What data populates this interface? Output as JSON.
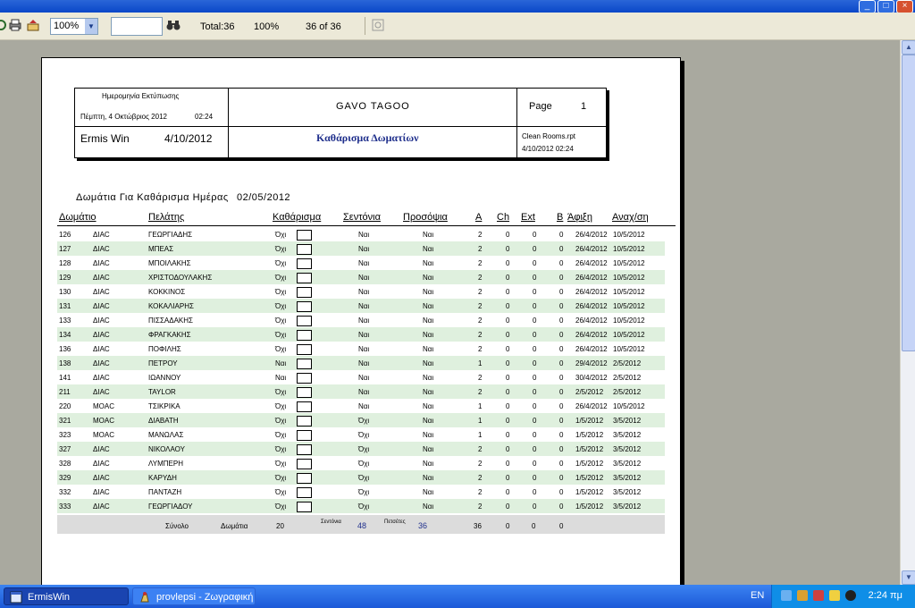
{
  "toolbar": {
    "zoom": "100%",
    "search_value": "",
    "total": "Total:36",
    "percent": "100%",
    "page_of": "36 of 36"
  },
  "report": {
    "print_date_label": "Ημερομηνία Εκτύπωσης",
    "print_date_value": "Πέμπτη, 4 Οκτώβριος 2012",
    "print_time": "02:24",
    "company": "GAVO TAGOO",
    "page_label": "Page",
    "page_number": "1",
    "app_name": "Ermis Win",
    "app_date": "4/10/2012",
    "report_title": "Καθάρισμα Δωματίων",
    "report_file": "Clean Rooms.rpt",
    "report_file_datetime": "4/10/2012  02:24",
    "section_title": "Δωμάτια Για Καθάρισμα Ημέρας",
    "section_date": "02/05/2012",
    "columns": [
      "Δωμάτιο",
      "Πελάτης",
      "Καθάρισμα",
      "Σεντόνια",
      "Προσόψια",
      "A",
      "Ch",
      "Ext",
      "B",
      "Άφιξη",
      "Αναχ/ση"
    ],
    "rows": [
      [
        "126",
        "ΔΙΑC",
        "ΓΕΩΡΓΙΑΔΗΣ",
        "Όχι",
        "Ναι",
        "Ναι",
        "2",
        "0",
        "0",
        "0",
        "26/4/2012",
        "10/5/2012"
      ],
      [
        "127",
        "ΔΙΑC",
        "ΜΠΕΑΣ",
        "Όχι",
        "Ναι",
        "Ναι",
        "2",
        "0",
        "0",
        "0",
        "26/4/2012",
        "10/5/2012"
      ],
      [
        "128",
        "ΔΙΑC",
        "ΜΠΟΙΛΑΚΗΣ",
        "Όχι",
        "Ναι",
        "Ναι",
        "2",
        "0",
        "0",
        "0",
        "26/4/2012",
        "10/5/2012"
      ],
      [
        "129",
        "ΔΙΑC",
        "ΧΡΙΣΤΟΔΟΥΛΑΚΗΣ",
        "Όχι",
        "Ναι",
        "Ναι",
        "2",
        "0",
        "0",
        "0",
        "26/4/2012",
        "10/5/2012"
      ],
      [
        "130",
        "ΔΙΑC",
        "ΚΟΚΚΙΝΟΣ",
        "Όχι",
        "Ναι",
        "Ναι",
        "2",
        "0",
        "0",
        "0",
        "26/4/2012",
        "10/5/2012"
      ],
      [
        "131",
        "ΔΙΑC",
        "ΚΟΚΑΛΙΑΡΗΣ",
        "Όχι",
        "Ναι",
        "Ναι",
        "2",
        "0",
        "0",
        "0",
        "26/4/2012",
        "10/5/2012"
      ],
      [
        "133",
        "ΔΙΑC",
        "ΠΙΣΣΑΔΑΚΗΣ",
        "Όχι",
        "Ναι",
        "Ναι",
        "2",
        "0",
        "0",
        "0",
        "26/4/2012",
        "10/5/2012"
      ],
      [
        "134",
        "ΔΙΑC",
        "ΦΡΑΓΚΑΚΗΣ",
        "Όχι",
        "Ναι",
        "Ναι",
        "2",
        "0",
        "0",
        "0",
        "26/4/2012",
        "10/5/2012"
      ],
      [
        "136",
        "ΔΙΑC",
        "ΠΟΦΙΛΗΣ",
        "Όχι",
        "Ναι",
        "Ναι",
        "2",
        "0",
        "0",
        "0",
        "26/4/2012",
        "10/5/2012"
      ],
      [
        "138",
        "ΔΙΑC",
        "ΠΕΤΡΟΥ",
        "Ναι",
        "Ναι",
        "Ναι",
        "1",
        "0",
        "0",
        "0",
        "29/4/2012",
        "2/5/2012"
      ],
      [
        "141",
        "ΔΙΑC",
        "ΙΩΑΝΝΟΥ",
        "Ναι",
        "Ναι",
        "Ναι",
        "2",
        "0",
        "0",
        "0",
        "30/4/2012",
        "2/5/2012"
      ],
      [
        "211",
        "ΔΙΑC",
        "TAYLOR",
        "Όχι",
        "Ναι",
        "Ναι",
        "2",
        "0",
        "0",
        "0",
        "2/5/2012",
        "2/5/2012"
      ],
      [
        "220",
        "MOAC",
        "ΤΣΙΚΡΙΚΑ",
        "Όχι",
        "Ναι",
        "Ναι",
        "1",
        "0",
        "0",
        "0",
        "26/4/2012",
        "10/5/2012"
      ],
      [
        "321",
        "MOAC",
        "ΔΙΑΒΑΤΗ",
        "Όχι",
        "Όχι",
        "Ναι",
        "1",
        "0",
        "0",
        "0",
        "1/5/2012",
        "3/5/2012"
      ],
      [
        "323",
        "MOAC",
        "ΜΑΝΩΛΑΣ",
        "Όχι",
        "Όχι",
        "Ναι",
        "1",
        "0",
        "0",
        "0",
        "1/5/2012",
        "3/5/2012"
      ],
      [
        "327",
        "ΔΙΑC",
        "ΝΙΚΟΛΑΟΥ",
        "Όχι",
        "Όχι",
        "Ναι",
        "2",
        "0",
        "0",
        "0",
        "1/5/2012",
        "3/5/2012"
      ],
      [
        "328",
        "ΔΙΑC",
        "ΛΥΜΠΕΡΗ",
        "Όχι",
        "Όχι",
        "Ναι",
        "2",
        "0",
        "0",
        "0",
        "1/5/2012",
        "3/5/2012"
      ],
      [
        "329",
        "ΔΙΑC",
        "ΚΑΡΥΔΗ",
        "Όχι",
        "Όχι",
        "Ναι",
        "2",
        "0",
        "0",
        "0",
        "1/5/2012",
        "3/5/2012"
      ],
      [
        "332",
        "ΔΙΑC",
        "ΠΑΝΤΑΖΗ",
        "Όχι",
        "Όχι",
        "Ναι",
        "2",
        "0",
        "0",
        "0",
        "1/5/2012",
        "3/5/2012"
      ],
      [
        "333",
        "ΔΙΑC",
        "ΓΕΩΡΓΙΑΔΟΥ",
        "Όχι",
        "Όχι",
        "Ναι",
        "2",
        "0",
        "0",
        "0",
        "1/5/2012",
        "3/5/2012"
      ]
    ],
    "totals": {
      "label": "Σύνολο",
      "rooms_label": "Δωμάτια",
      "rooms": "20",
      "sheets_label": "Σεντόνια",
      "sheets": "48",
      "towels_label": "Πετσέτες",
      "towels": "36",
      "a": "36",
      "ch": "0",
      "ext": "0",
      "b": "0"
    }
  },
  "taskbar": {
    "items": [
      "ErmisWin",
      "provlepsi - Ζωγραφική"
    ],
    "lang": "EN",
    "clock": "2:24 πμ"
  },
  "colors": {
    "row_alt": "#dff0de",
    "taskbar": "#245edb",
    "tray": "#0f8ee7",
    "viewer_bg": "#a9a99f"
  }
}
